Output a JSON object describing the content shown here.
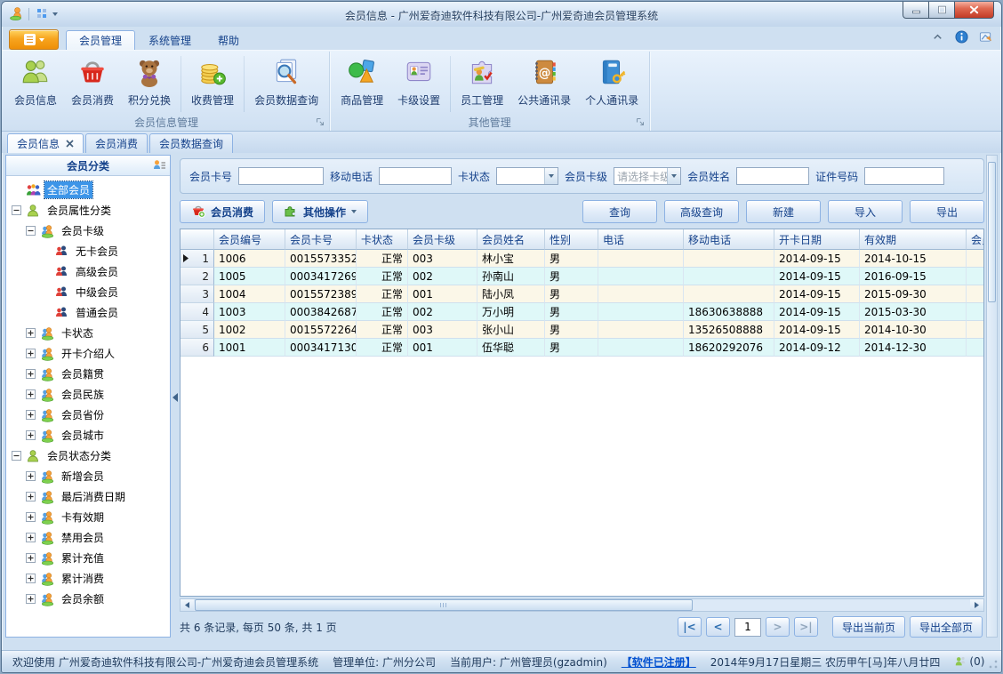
{
  "colors": {
    "accent_orange": "#f5a51f",
    "selection_blue": "#3d95e8",
    "row_cream": "#fbf7e8",
    "row_cyan": "#dff8f8",
    "link_blue": "#0050d0",
    "close_red": "#c23b26",
    "header_text": "#15428b"
  },
  "window": {
    "title": "会员信息 - 广州爱奇迪软件科技有限公司-广州爱奇迪会员管理系统",
    "quick_access_icons": [
      "app-logo-icon",
      "layout-grid-icon",
      "dropdown-arrow-icon"
    ]
  },
  "ribbon": {
    "tabs": [
      {
        "label": "会员管理",
        "active": true
      },
      {
        "label": "系统管理",
        "active": false
      },
      {
        "label": "帮助",
        "active": false
      }
    ],
    "right_icons": [
      "chevron-up-icon",
      "info-icon",
      "feedback-icon"
    ],
    "groups": [
      {
        "label": "会员信息管理",
        "items": [
          {
            "key": "member_info",
            "label": "会员信息",
            "icon": "members-icon"
          },
          {
            "key": "member_consume",
            "label": "会员消费",
            "icon": "basket-icon"
          },
          {
            "key": "points_exchange",
            "label": "积分兑换",
            "icon": "teddy-icon"
          },
          {
            "key": "fee_mgmt",
            "label": "收费管理",
            "icon": "coins-icon"
          },
          {
            "key": "member_data_query",
            "label": "会员数据查询",
            "icon": "doc-search-icon"
          }
        ]
      },
      {
        "label": "其他管理",
        "items": [
          {
            "key": "goods_mgmt",
            "label": "商品管理",
            "icon": "goods-icon"
          },
          {
            "key": "card_level_set",
            "label": "卡级设置",
            "icon": "card-icon"
          },
          {
            "key": "staff_mgmt",
            "label": "员工管理",
            "icon": "staff-icon"
          },
          {
            "key": "public_contacts",
            "label": "公共通讯录",
            "icon": "address-book-icon"
          },
          {
            "key": "personal_contacts",
            "label": "个人通讯录",
            "icon": "personal-book-icon"
          }
        ]
      }
    ]
  },
  "doc_tabs": [
    {
      "label": "会员信息",
      "active": true,
      "closable": true
    },
    {
      "label": "会员消费",
      "active": false,
      "closable": false
    },
    {
      "label": "会员数据查询",
      "active": false,
      "closable": false
    }
  ],
  "sidebar": {
    "header": "会员分类",
    "header_icon": "tree-settings-icon",
    "items": [
      {
        "label": "全部会员",
        "level": 0,
        "expand": null,
        "icon": "all-members-icon",
        "selected": true
      },
      {
        "label": "会员属性分类",
        "level": 0,
        "expand": "minus",
        "icon": "green-people-icon"
      },
      {
        "label": "会员卡级",
        "level": 1,
        "expand": "minus",
        "icon": "orange-people-icon"
      },
      {
        "label": "无卡会员",
        "level": 2,
        "expand": null,
        "icon": "couple-icon"
      },
      {
        "label": "高级会员",
        "level": 2,
        "expand": null,
        "icon": "couple-icon"
      },
      {
        "label": "中级会员",
        "level": 2,
        "expand": null,
        "icon": "couple-icon"
      },
      {
        "label": "普通会员",
        "level": 2,
        "expand": null,
        "icon": "couple-icon"
      },
      {
        "label": "卡状态",
        "level": 1,
        "expand": "plus",
        "icon": "orange-people-icon"
      },
      {
        "label": "开卡介绍人",
        "level": 1,
        "expand": "plus",
        "icon": "orange-people-icon"
      },
      {
        "label": "会员籍贯",
        "level": 1,
        "expand": "plus",
        "icon": "orange-people-icon"
      },
      {
        "label": "会员民族",
        "level": 1,
        "expand": "plus",
        "icon": "orange-people-icon"
      },
      {
        "label": "会员省份",
        "level": 1,
        "expand": "plus",
        "icon": "orange-people-icon"
      },
      {
        "label": "会员城市",
        "level": 1,
        "expand": "plus",
        "icon": "orange-people-icon"
      },
      {
        "label": "会员状态分类",
        "level": 0,
        "expand": "minus",
        "icon": "green-people-icon"
      },
      {
        "label": "新增会员",
        "level": 1,
        "expand": "plus",
        "icon": "orange-people-icon"
      },
      {
        "label": "最后消费日期",
        "level": 1,
        "expand": "plus",
        "icon": "orange-people-icon"
      },
      {
        "label": "卡有效期",
        "level": 1,
        "expand": "plus",
        "icon": "orange-people-icon"
      },
      {
        "label": "禁用会员",
        "level": 1,
        "expand": "plus",
        "icon": "orange-people-icon"
      },
      {
        "label": "累计充值",
        "level": 1,
        "expand": "plus",
        "icon": "orange-people-icon"
      },
      {
        "label": "累计消费",
        "level": 1,
        "expand": "plus",
        "icon": "orange-people-icon"
      },
      {
        "label": "会员余额",
        "level": 1,
        "expand": "plus",
        "icon": "orange-people-icon"
      }
    ]
  },
  "search": {
    "fields": [
      {
        "key": "card_no",
        "label": "会员卡号",
        "type": "text",
        "value": ""
      },
      {
        "key": "mobile",
        "label": "移动电话",
        "type": "text",
        "value": ""
      },
      {
        "key": "card_status",
        "label": "卡状态",
        "type": "select",
        "value": "",
        "placeholder": false
      },
      {
        "key": "card_level",
        "label": "会员卡级",
        "type": "select",
        "value": "请选择卡级",
        "placeholder": true
      },
      {
        "key": "name",
        "label": "会员姓名",
        "type": "text",
        "value": ""
      },
      {
        "key": "id_no",
        "label": "证件号码",
        "type": "text",
        "value": ""
      }
    ]
  },
  "toolbar": {
    "left": [
      {
        "key": "member_consume",
        "label": "会员消费",
        "icon": "basket-add-icon",
        "dropdown": false
      },
      {
        "key": "other_ops",
        "label": "其他操作",
        "icon": "puzzle-icon",
        "dropdown": true
      }
    ],
    "right": [
      {
        "key": "query",
        "label": "查询"
      },
      {
        "key": "adv_query",
        "label": "高级查询"
      },
      {
        "key": "new",
        "label": "新建"
      },
      {
        "key": "import",
        "label": "导入"
      },
      {
        "key": "export",
        "label": "导出"
      }
    ]
  },
  "grid": {
    "columns": [
      "会员编号",
      "会员卡号",
      "卡状态",
      "会员卡级",
      "会员姓名",
      "性别",
      "电话",
      "移动电话",
      "开卡日期",
      "有效期",
      "会员"
    ],
    "current_row": 1,
    "rows": [
      [
        "1006",
        "0015573352",
        "正常",
        "003",
        "林小宝",
        "男",
        "",
        "",
        "2014-09-15",
        "2014-10-15",
        ""
      ],
      [
        "1005",
        "0003417269",
        "正常",
        "002",
        "孙南山",
        "男",
        "",
        "",
        "2014-09-15",
        "2016-09-15",
        ""
      ],
      [
        "1004",
        "0015572389",
        "正常",
        "001",
        "陆小凤",
        "男",
        "",
        "",
        "2014-09-15",
        "2015-09-30",
        ""
      ],
      [
        "1003",
        "0003842687",
        "正常",
        "002",
        "万小明",
        "男",
        "",
        "18630638888",
        "2014-09-15",
        "2015-03-30",
        ""
      ],
      [
        "1002",
        "0015572264",
        "正常",
        "003",
        "张小山",
        "男",
        "",
        "13526508888",
        "2014-09-15",
        "2014-10-30",
        ""
      ],
      [
        "1001",
        "0003417130",
        "正常",
        "001",
        "伍华聪",
        "男",
        "",
        "18620292076",
        "2014-09-12",
        "2014-12-30",
        ""
      ]
    ]
  },
  "pager": {
    "summary": "共 6 条记录, 每页 50 条, 共 1 页",
    "first": "|<",
    "prev": "<",
    "page": "1",
    "next": ">",
    "last": ">|",
    "export_current": "导出当前页",
    "export_all": "导出全部页"
  },
  "statusbar": {
    "welcome": "欢迎使用 广州爱奇迪软件科技有限公司-广州爱奇迪会员管理系统",
    "org": "管理单位: 广州分公司",
    "user": "当前用户: 广州管理员(gzadmin)",
    "registered_link": "【软件已注册】",
    "datetime": "2014年9月17日星期三 农历甲午[马]年八月廿四",
    "online_count": "(0)"
  }
}
